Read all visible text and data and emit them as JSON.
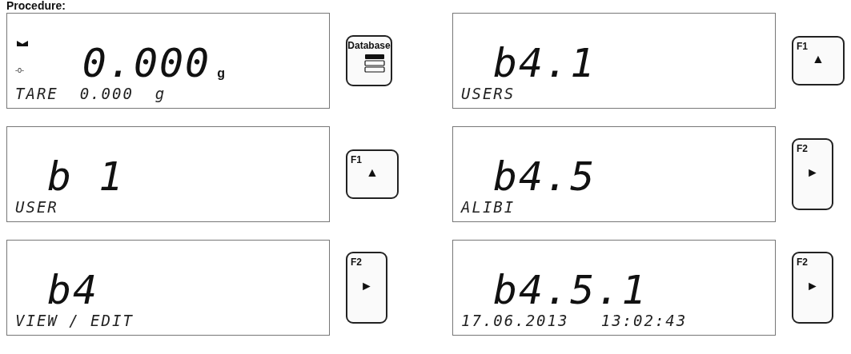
{
  "heading": "Procedure:",
  "steps": [
    {
      "display": {
        "main": "0.000",
        "unit": "g",
        "zero_indicator": "-0-",
        "sub": "TARE  0.000  g"
      },
      "key": {
        "kind": "database",
        "label": "Database"
      }
    },
    {
      "display": {
        "main": "b 1",
        "sub": "USER"
      },
      "key": {
        "kind": "f",
        "label": "F1",
        "glyph": "▲"
      }
    },
    {
      "display": {
        "main": "b4",
        "sub": "VIEW / EDIT"
      },
      "key": {
        "kind": "f",
        "label": "F2",
        "glyph": "►"
      }
    },
    {
      "display": {
        "main": "b4.1",
        "sub": "USERS"
      },
      "key": {
        "kind": "f",
        "label": "F1",
        "glyph": "▲"
      }
    },
    {
      "display": {
        "main": "b4.5",
        "sub": "ALIBI"
      },
      "key": {
        "kind": "f",
        "label": "F2",
        "glyph": "►"
      }
    },
    {
      "display": {
        "main": "b4.5.1",
        "sub": "17.06.2013   13:02:43"
      },
      "key": {
        "kind": "f",
        "label": "F2",
        "glyph": "►"
      }
    }
  ]
}
